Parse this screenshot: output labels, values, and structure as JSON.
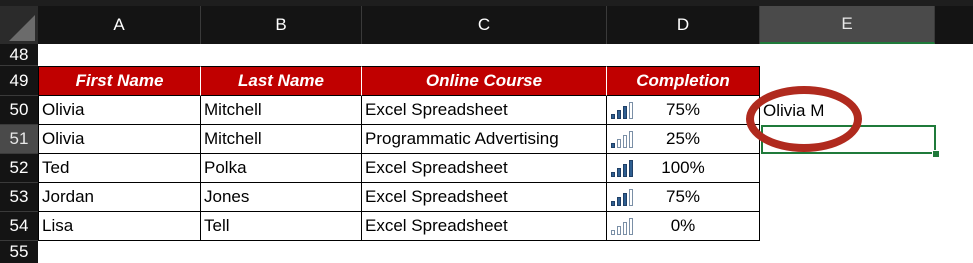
{
  "columns": [
    "A",
    "B",
    "C",
    "D",
    "E"
  ],
  "selected_column": "E",
  "row_numbers": [
    "48",
    "49",
    "50",
    "51",
    "52",
    "53",
    "54",
    "55"
  ],
  "selected_row": "51",
  "table": {
    "headers": [
      "First Name",
      "Last Name",
      "Online Course",
      "Completion"
    ],
    "rows": [
      {
        "first": "Olivia",
        "last": "Mitchell",
        "course": "Excel Spreadsheet",
        "completion": "75%",
        "signal_bars": 3
      },
      {
        "first": "Olivia",
        "last": "Mitchell",
        "course": "Programmatic Advertising",
        "completion": "25%",
        "signal_bars": 1
      },
      {
        "first": "Ted",
        "last": "Polka",
        "course": "Excel Spreadsheet",
        "completion": "100%",
        "signal_bars": 4
      },
      {
        "first": "Jordan",
        "last": "Jones",
        "course": "Excel Spreadsheet",
        "completion": "75%",
        "signal_bars": 3
      },
      {
        "first": "Lisa",
        "last": "Tell",
        "course": "Excel Spreadsheet",
        "completion": "0%",
        "signal_bars": 0
      }
    ]
  },
  "e50_value": "Olivia M",
  "colors": {
    "header_fill": "#c00000",
    "header_text": "#ffffff",
    "annotation_ellipse": "#b02a1e",
    "selection_border": "#1f7a3a",
    "bar_filled": "#2f5f91"
  },
  "icons": {
    "signal": "signal-bars-icon",
    "select_all": "select-all-triangle-icon"
  }
}
